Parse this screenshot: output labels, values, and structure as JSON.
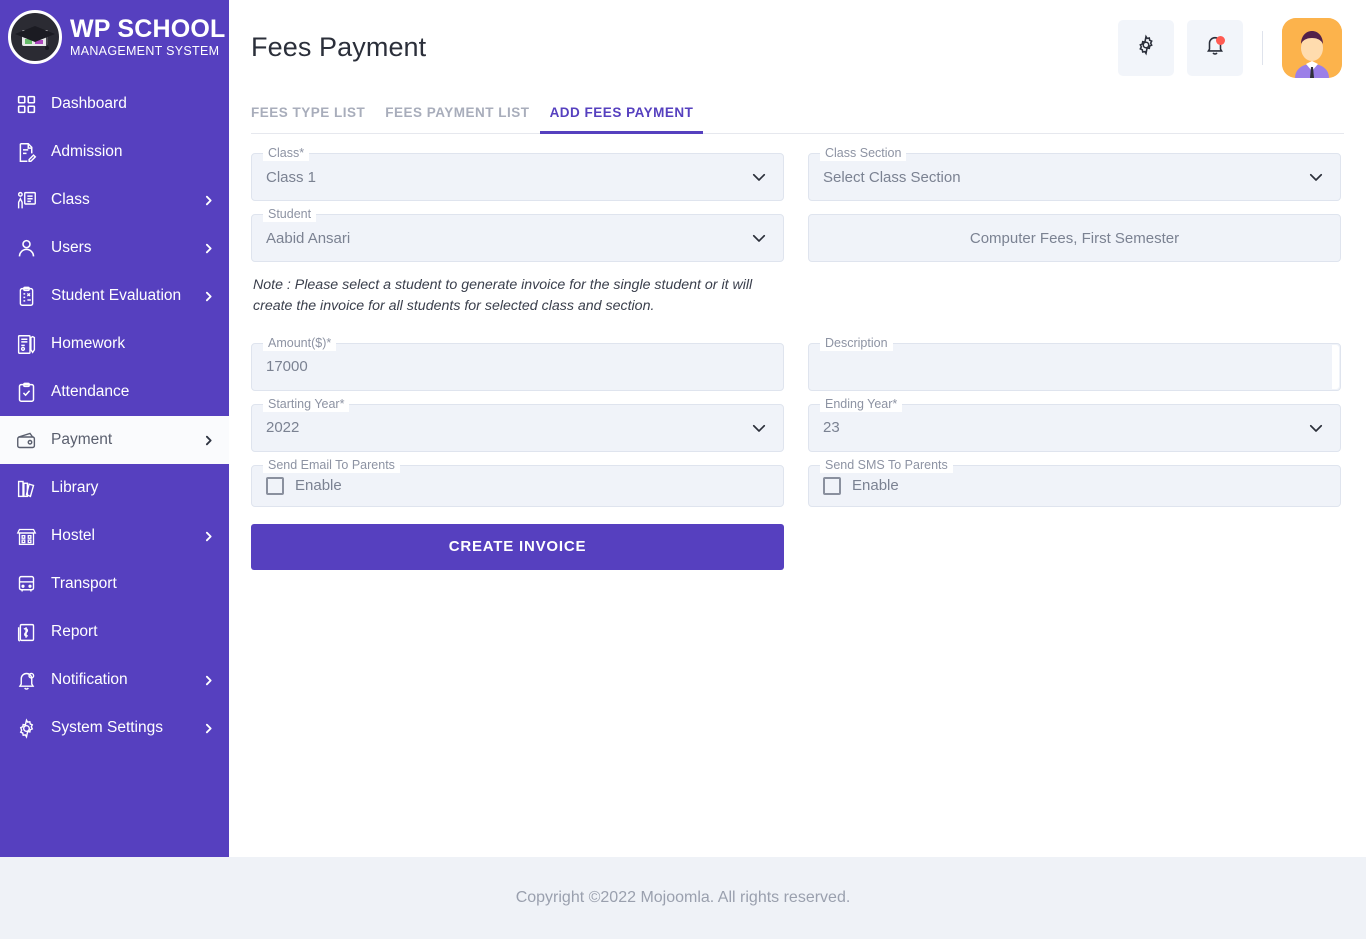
{
  "brand": {
    "title": "WP SCHOOL",
    "subtitle": "MANAGEMENT SYSTEM",
    "logo_icon": "graduation-cap-logo"
  },
  "sidebar": {
    "background_color": "#5640bf",
    "active_item": "Payment",
    "items": [
      {
        "label": "Dashboard",
        "icon": "grid-icon",
        "has_chevron": false
      },
      {
        "label": "Admission",
        "icon": "document-pen-icon",
        "has_chevron": false
      },
      {
        "label": "Class",
        "icon": "teacher-board-icon",
        "has_chevron": true
      },
      {
        "label": "Users",
        "icon": "user-icon",
        "has_chevron": true
      },
      {
        "label": "Student Evaluation",
        "icon": "clipboard-check-icon",
        "has_chevron": true
      },
      {
        "label": "Homework",
        "icon": "book-pen-icon",
        "has_chevron": false
      },
      {
        "label": "Attendance",
        "icon": "clipboard-tick-icon",
        "has_chevron": false
      },
      {
        "label": "Payment",
        "icon": "wallet-icon",
        "has_chevron": true
      },
      {
        "label": "Library",
        "icon": "books-icon",
        "has_chevron": false
      },
      {
        "label": "Hostel",
        "icon": "building-icon",
        "has_chevron": true
      },
      {
        "label": "Transport",
        "icon": "bus-icon",
        "has_chevron": false
      },
      {
        "label": "Report",
        "icon": "report-icon",
        "has_chevron": false
      },
      {
        "label": "Notification",
        "icon": "bell-icon",
        "has_chevron": true
      },
      {
        "label": "System Settings",
        "icon": "gear-icon",
        "has_chevron": true
      }
    ]
  },
  "header": {
    "title": "Fees Payment",
    "settings_icon": "gear-icon",
    "notification_icon": "bell-icon",
    "notification_dot_color": "#ff5b52",
    "avatar_icon": "user-avatar"
  },
  "tabs": [
    {
      "label": "FEES TYPE LIST",
      "active": false
    },
    {
      "label": "FEES PAYMENT LIST",
      "active": false
    },
    {
      "label": "ADD FEES PAYMENT",
      "active": true
    }
  ],
  "accent_color": "#5640bf",
  "form": {
    "class": {
      "legend": "Class*",
      "value": "Class 1",
      "caret_icon": "chevron-down-icon"
    },
    "class_section": {
      "legend": "Class Section",
      "value": "Select Class Section",
      "caret_icon": "chevron-down-icon"
    },
    "student": {
      "legend": "Student",
      "value": "Aabid Ansari",
      "caret_icon": "chevron-down-icon"
    },
    "fees_type_display": {
      "value": "Computer Fees, First Semester"
    },
    "note": "Note : Please select a student to generate invoice for the single student or it will create the invoice for all students for selected class and section.",
    "amount": {
      "legend": "Amount($)*",
      "value": "17000"
    },
    "description": {
      "legend": "Description",
      "value": ""
    },
    "starting_year": {
      "legend": "Starting Year*",
      "value": "2022",
      "caret_icon": "chevron-down-icon"
    },
    "ending_year": {
      "legend": "Ending Year*",
      "value": "23",
      "caret_icon": "chevron-down-icon"
    },
    "send_email": {
      "legend": "Send Email To Parents",
      "checkbox_label": "Enable",
      "checked": false
    },
    "send_sms": {
      "legend": "Send SMS To Parents",
      "checkbox_label": "Enable",
      "checked": false
    },
    "submit_label": "CREATE INVOICE"
  },
  "footer": {
    "text": "Copyright ©2022 Mojoomla. All rights reserved."
  }
}
